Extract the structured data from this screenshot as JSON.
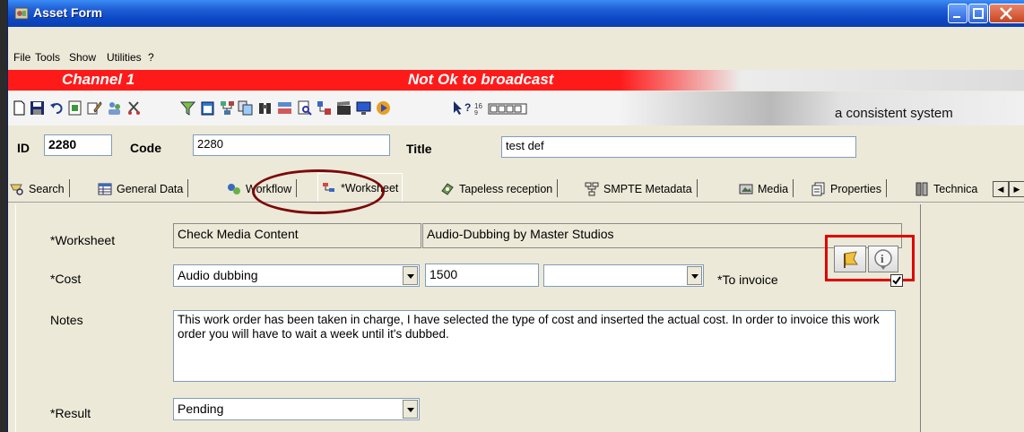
{
  "window": {
    "title": "Asset Form"
  },
  "menu": [
    "File",
    "Tools",
    "Show",
    "Utilities",
    "?"
  ],
  "status_bar": {
    "channel": "Channel 1",
    "broadcast_status": "Not Ok to broadcast",
    "color": "#ff1a1a"
  },
  "toolbar": {
    "slogan": "a consistent system",
    "help_label": "?"
  },
  "asset": {
    "id_label": "ID",
    "id_value": "2280",
    "code_label": "Code",
    "code_value": "2280",
    "title_label": "Title",
    "title_value": "test def"
  },
  "tabs": [
    {
      "label": "Search",
      "icon": "search-icon"
    },
    {
      "label": "General Data",
      "icon": "table-icon"
    },
    {
      "label": "Workflow",
      "icon": "workflow-icon"
    },
    {
      "label": "*Worksheet",
      "icon": "worksheet-icon",
      "active": true
    },
    {
      "label": "Tapeless reception",
      "icon": "reception-icon"
    },
    {
      "label": "SMPTE Metadata",
      "icon": "metadata-icon"
    },
    {
      "label": "Media",
      "icon": "media-icon"
    },
    {
      "label": "Properties",
      "icon": "properties-icon"
    },
    {
      "label": "Technica",
      "icon": "technical-icon"
    }
  ],
  "worksheet": {
    "worksheet_label": "*Worksheet",
    "worksheet_value": "Check Media Content",
    "worksheet_provider": "Audio-Dubbing by Master Studios",
    "cost_label": "*Cost",
    "cost_type": "Audio dubbing",
    "cost_amount": "1500",
    "cost_extra": "",
    "invoice_label": "*To invoice",
    "invoice_checked": true,
    "notes_label": "Notes",
    "notes": "This work order has been taken in charge, I have selected the type of cost and inserted the actual cost. In order to invoice this work order you will have to wait a week until it's dubbed.",
    "result_label": "*Result",
    "result_value": "Pending"
  }
}
